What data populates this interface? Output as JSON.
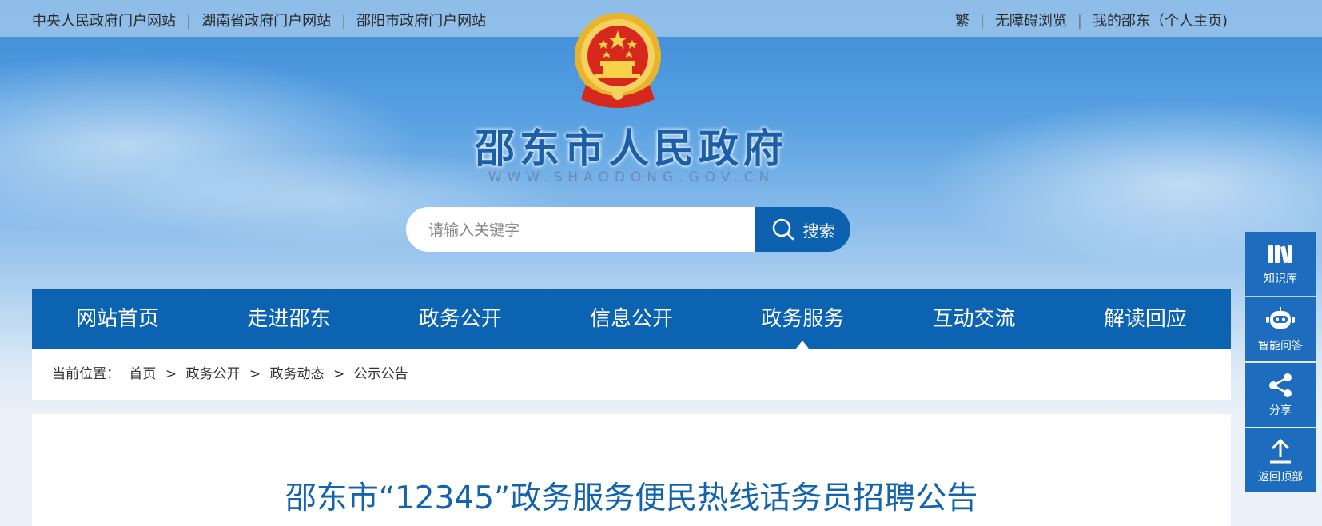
{
  "topbar": {
    "links_left": [
      "中央人民政府门户网站",
      "湖南省政府门户网站",
      "邵阳市政府门户网站"
    ],
    "links_right": [
      "繁",
      "无障碍浏览",
      "我的邵东（个人主页)"
    ]
  },
  "header": {
    "title": "邵东市人民政府",
    "url": "WWW.SHAODONG.GOV.CN"
  },
  "search": {
    "placeholder": "请输入关键字",
    "button_label": "搜索"
  },
  "nav": {
    "items": [
      "网站首页",
      "走进邵东",
      "政务公开",
      "信息公开",
      "政务服务",
      "互动交流",
      "解读回应"
    ],
    "active": "政务服务"
  },
  "breadcrumb": {
    "label": "当前位置：",
    "items": [
      "首页",
      "政务公开",
      "政务动态",
      "公示公告"
    ],
    "separator": ">"
  },
  "article": {
    "title": "邵东市“12345”政务服务便民热线话务员招聘公告"
  },
  "sidebar": {
    "items": [
      {
        "label": "知识库",
        "icon": "books-icon"
      },
      {
        "label": "智能问答",
        "icon": "robot-icon"
      },
      {
        "label": "分享",
        "icon": "share-icon"
      },
      {
        "label": "返回顶部",
        "icon": "arrow-up-icon"
      }
    ]
  },
  "colors": {
    "nav": "#0b63b1",
    "title": "#1363ad",
    "sidebar": "#1d6cbd"
  }
}
